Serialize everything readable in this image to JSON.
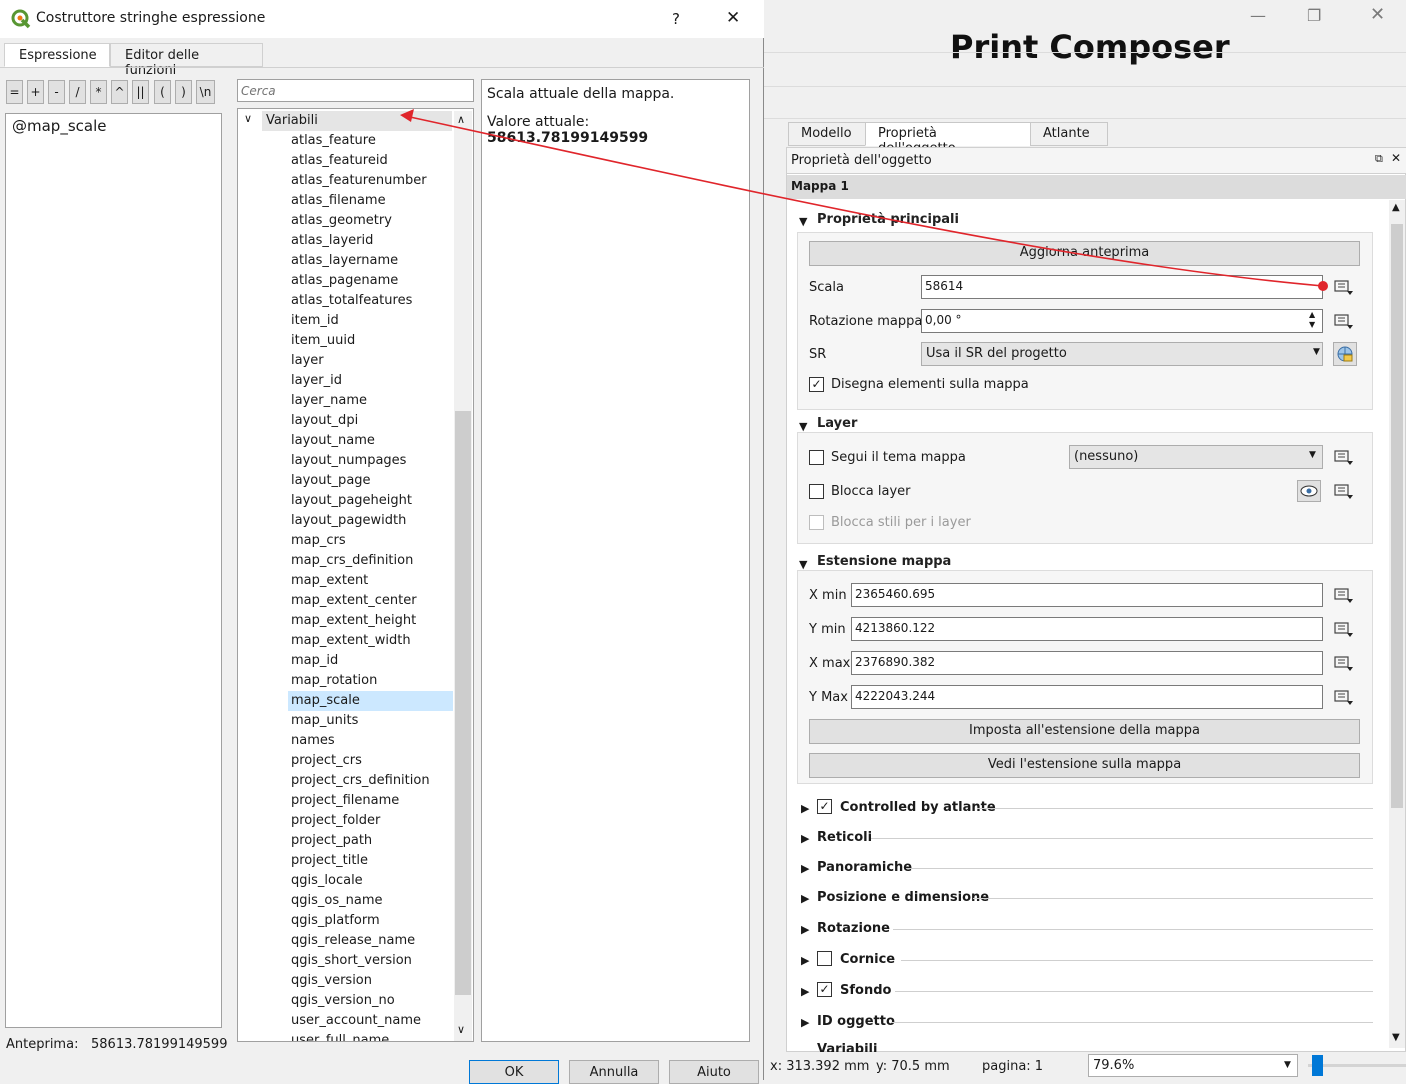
{
  "composer": {
    "title": "Print Composer",
    "tabs": [
      "Modello",
      "Proprietà dell'oggetto",
      "Atlante"
    ],
    "dock_title": "Proprietà dell'oggetto",
    "item_title": "Mappa 1",
    "main_props": {
      "title": "Proprietà principali",
      "update_preview": "Aggiorna anteprima",
      "scale_label": "Scala",
      "scale_value": "58614",
      "rotation_label": "Rotazione mappa",
      "rotation_value": "0,00 °",
      "crs_label": "SR",
      "crs_value": "Usa il SR del progetto",
      "draw_items": "Disegna elementi sulla mappa"
    },
    "layers": {
      "title": "Layer",
      "follow_theme": "Segui il tema mappa",
      "theme_value": "(nessuno)",
      "lock_layers": "Blocca layer",
      "lock_styles": "Blocca stili per i layer"
    },
    "extent": {
      "title": "Estensione mappa",
      "xmin_label": "X min",
      "xmin": "2365460.695",
      "ymin_label": "Y min",
      "ymin": "4213860.122",
      "xmax_label": "X max",
      "xmax": "2376890.382",
      "ymax_label": "Y Max",
      "ymax": "4222043.244",
      "set_extent": "Imposta all'estensione della mappa",
      "view_extent": "Vedi l'estensione sulla mappa"
    },
    "collapsed_groups": [
      "Controlled by atlante",
      "Reticoli",
      "Panoramiche",
      "Posizione e dimensione",
      "Rotazione",
      "Cornice",
      "Sfondo",
      "ID oggetto",
      "Variabili"
    ],
    "status": {
      "x": "x: 313.392 mm",
      "y": "y: 70.5 mm",
      "page": "pagina: 1",
      "zoom": "79.6%"
    }
  },
  "dialog": {
    "title": "Costruttore stringhe espressione",
    "help": "?",
    "tabs": [
      "Espressione",
      "Editor delle funzioni"
    ],
    "operators": [
      "=",
      "+",
      "-",
      "/",
      "*",
      "^",
      "||",
      "(",
      ")",
      "\\n"
    ],
    "expression": "@map_scale",
    "search_placeholder": "Cerca",
    "tree_group": "Variabili",
    "variables": [
      "atlas_feature",
      "atlas_featureid",
      "atlas_featurenumber",
      "atlas_filename",
      "atlas_geometry",
      "atlas_layerid",
      "atlas_layername",
      "atlas_pagename",
      "atlas_totalfeatures",
      "item_id",
      "item_uuid",
      "layer",
      "layer_id",
      "layer_name",
      "layout_dpi",
      "layout_name",
      "layout_numpages",
      "layout_page",
      "layout_pageheight",
      "layout_pagewidth",
      "map_crs",
      "map_crs_definition",
      "map_extent",
      "map_extent_center",
      "map_extent_height",
      "map_extent_width",
      "map_id",
      "map_rotation",
      "map_scale",
      "map_units",
      "names",
      "project_crs",
      "project_crs_definition",
      "project_filename",
      "project_folder",
      "project_path",
      "project_title",
      "qgis_locale",
      "qgis_os_name",
      "qgis_platform",
      "qgis_release_name",
      "qgis_short_version",
      "qgis_version",
      "qgis_version_no",
      "user_account_name",
      "user_full_name"
    ],
    "selected_variable": "map_scale",
    "help_text": "Scala attuale della mappa.",
    "current_value_label": "Valore attuale:",
    "current_value": "58613.78199149599",
    "preview_label": "Anteprima:",
    "preview_value": "58613.78199149599",
    "buttons": {
      "ok": "OK",
      "cancel": "Annulla",
      "help": "Aiuto"
    }
  },
  "colors": {
    "accent": "#e0252b",
    "selection": "#cce8ff",
    "qgis_green": "#589632"
  }
}
